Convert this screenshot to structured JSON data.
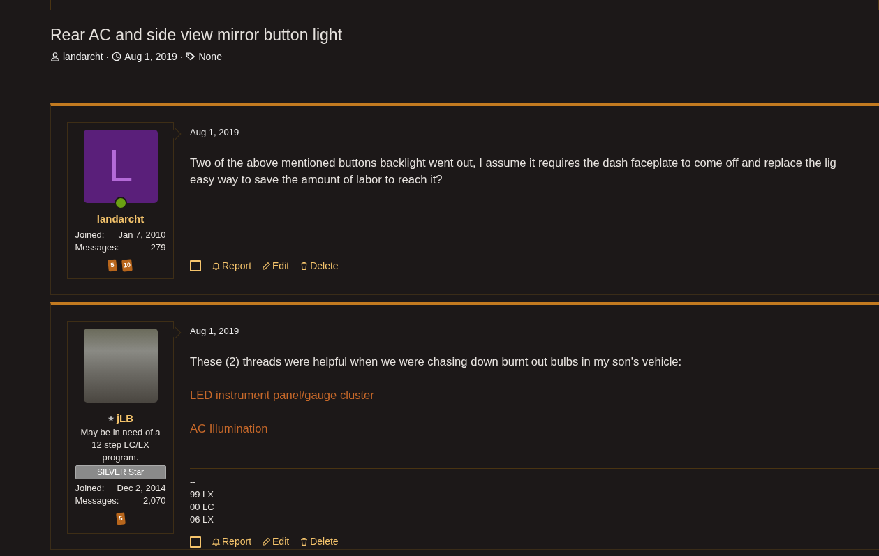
{
  "thread": {
    "title": "Rear AC and side view mirror button light",
    "author": "landarcht",
    "date": "Aug 1, 2019",
    "tags": "None",
    "separator": "·"
  },
  "posts": [
    {
      "author": {
        "name": "landarcht",
        "avatar": {
          "kind": "letter",
          "letter": "L"
        },
        "online": true,
        "starred": false,
        "stats": [
          {
            "label": "Joined:",
            "value": "Jan 7, 2010"
          },
          {
            "label": "Messages:",
            "value": "279"
          }
        ],
        "trophies": [
          "5",
          "10"
        ]
      },
      "date": "Aug 1, 2019",
      "body": [
        {
          "kind": "paragraph",
          "lines": [
            "Two of the above mentioned buttons backlight went out, I assume it requires the dash faceplate to come off and replace the lig",
            "easy way to save the amount of labor to reach it?"
          ]
        }
      ],
      "actions": [
        {
          "kind": "select",
          "checked": false
        },
        {
          "kind": "report",
          "label": "Report"
        },
        {
          "kind": "edit",
          "label": "Edit"
        },
        {
          "kind": "delete",
          "label": "Delete"
        }
      ]
    },
    {
      "author": {
        "name": "jLB",
        "avatar": {
          "kind": "photo"
        },
        "online": false,
        "starred": true,
        "user_title": "May be in need of a 12 step LC/LX program.",
        "banner": "SILVER Star",
        "stats": [
          {
            "label": "Joined:",
            "value": "Dec 2, 2014"
          },
          {
            "label": "Messages:",
            "value": "2,070"
          }
        ],
        "trophies": [
          "5"
        ]
      },
      "date": "Aug 1, 2019",
      "body": [
        {
          "kind": "paragraph",
          "lines": [
            "These (2) threads were helpful when we were chasing down burnt out bulbs in my son's vehicle:"
          ]
        },
        {
          "kind": "link",
          "text": "LED instrument panel/gauge cluster"
        },
        {
          "kind": "link",
          "text": "AC Illumination"
        }
      ],
      "signature": [
        "--",
        "99 LX",
        "00 LC",
        "06 LX"
      ],
      "actions": [
        {
          "kind": "select",
          "checked": false
        },
        {
          "kind": "report",
          "label": "Report"
        },
        {
          "kind": "edit",
          "label": "Edit"
        },
        {
          "kind": "delete",
          "label": "Delete"
        }
      ]
    }
  ]
}
